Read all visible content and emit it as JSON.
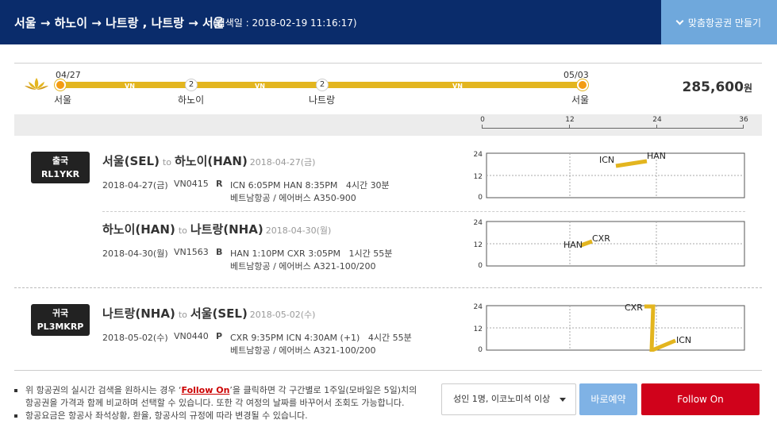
{
  "header": {
    "route": "서울 → 하노이 → 나트랑 , 나트랑 → 서울",
    "search_date": "(검색일 : 2018-02-19 11:16:17)",
    "make_button": "맞춤항공권 만들기"
  },
  "summary": {
    "start_date": "04/27",
    "end_date": "05/03",
    "segments": [
      "VN",
      "VN",
      "VN"
    ],
    "stops": [
      "2",
      "2"
    ],
    "cities": [
      "서울",
      "하노이",
      "나트랑",
      "서울"
    ],
    "price": "285,600",
    "currency": "원"
  },
  "timeline_axis": {
    "ticks": [
      "0",
      "12",
      "24",
      "36"
    ]
  },
  "segments": [
    {
      "badge_line1": "출국",
      "badge_line2": "RL1YKR",
      "from": "서울(SEL)",
      "to_word": "to",
      "to": "하노이(HAN)",
      "date_label": "2018-04-27(금)",
      "date": "2018-04-27(금)",
      "flight": "VN0415",
      "class": "R",
      "times": "ICN 6:05PM HAN 8:35PM",
      "duration": "4시간 30분",
      "carrier": "베트남항공 / 에어버스 A350-900",
      "chart": {
        "y_ticks": [
          "24",
          "12",
          "0"
        ],
        "dep_label": "ICN",
        "arr_label": "HAN",
        "dep_hour": 18.1,
        "arr_hour": 20.6,
        "dep_day_hour": 18.1,
        "arr_day_hour": 22.6
      }
    },
    {
      "badge_line1": "",
      "badge_line2": "",
      "from": "하노이(HAN)",
      "to_word": "to",
      "to": "나트랑(NHA)",
      "date_label": "2018-04-30(월)",
      "date": "2018-04-30(월)",
      "flight": "VN1563",
      "class": "B",
      "times": "HAN 1:10PM CXR 3:05PM",
      "duration": "1시간 55분",
      "carrier": "베트남항공 / 에어버스 A321-100/200",
      "chart": {
        "y_ticks": [
          "24",
          "12",
          "0"
        ],
        "dep_label": "HAN",
        "arr_label": "CXR"
      }
    },
    {
      "badge_line1": "귀국",
      "badge_line2": "PL3MKRP",
      "from": "나트랑(NHA)",
      "to_word": "to",
      "to": "서울(SEL)",
      "date_label": "2018-05-02(수)",
      "date": "2018-05-02(수)",
      "flight": "VN0440",
      "class": "P",
      "times": "CXR 9:35PM ICN 4:30AM (+1)",
      "duration": "4시간 55분",
      "carrier": "베트남항공 / 에어버스 A321-100/200",
      "chart": {
        "y_ticks": [
          "24",
          "12",
          "0"
        ],
        "dep_label": "CXR",
        "arr_label": "ICN"
      }
    }
  ],
  "footer": {
    "note1_pre": "위 항공권의 실시간 검색을 원하시는 경우 ‘",
    "note1_link": "Follow On",
    "note1_post": "’을 클릭하면 각 구간별로 1주일(모바일은 5일)치의 항공권을 가격과 함께 비교하며 선택할 수 있습니다. 또한 각 여정의 날짜를 바꾸어서 조회도 가능합니다.",
    "note2": "항공요금은 항공사 좌석상황, 환율, 항공사의 규정에 따라 변경될 수 있습니다.",
    "passenger_select": "성인 1명, 이코노미석 이상",
    "book_button": "바로예약",
    "follow_button": "Follow On"
  },
  "colors": {
    "header_bg": "#0a2c6b",
    "route_bar": "#e3b51f",
    "endpoint": "#f39c12",
    "accent_blue": "#6fa8dc",
    "follow_red": "#d0021b"
  }
}
